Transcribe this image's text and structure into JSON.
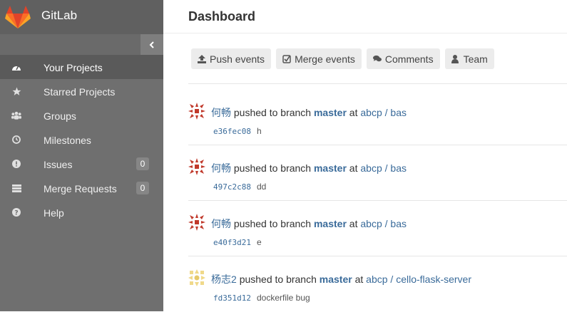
{
  "app": {
    "brand": "GitLab"
  },
  "sidebar": {
    "items": [
      {
        "label": "Your Projects",
        "icon": "dashboard-icon",
        "active": true,
        "count": null
      },
      {
        "label": "Starred Projects",
        "icon": "star-icon",
        "active": false,
        "count": null
      },
      {
        "label": "Groups",
        "icon": "users-icon",
        "active": false,
        "count": null
      },
      {
        "label": "Milestones",
        "icon": "clock-icon",
        "active": false,
        "count": null
      },
      {
        "label": "Issues",
        "icon": "exclamation-circle-icon",
        "active": false,
        "count": "0"
      },
      {
        "label": "Merge Requests",
        "icon": "list-icon",
        "active": false,
        "count": "0"
      },
      {
        "label": "Help",
        "icon": "question-circle-icon",
        "active": false,
        "count": null
      }
    ]
  },
  "main": {
    "title": "Dashboard",
    "filters": [
      {
        "label": "Push events",
        "icon": "upload-icon"
      },
      {
        "label": "Merge events",
        "icon": "check-square-icon"
      },
      {
        "label": "Comments",
        "icon": "comments-icon"
      },
      {
        "label": "Team",
        "icon": "user-icon"
      }
    ],
    "events": [
      {
        "author": "何畅",
        "action": "pushed to branch",
        "branch": "master",
        "at": "at",
        "project": "abcp / bas",
        "sha": "e36fec08",
        "message": "h"
      },
      {
        "author": "何畅",
        "action": "pushed to branch",
        "branch": "master",
        "at": "at",
        "project": "abcp / bas",
        "sha": "497c2c88",
        "message": "dd"
      },
      {
        "author": "何畅",
        "action": "pushed to branch",
        "branch": "master",
        "at": "at",
        "project": "abcp / bas",
        "sha": "e40f3d21",
        "message": "e"
      },
      {
        "author": "杨志2",
        "action": "pushed to branch",
        "branch": "master",
        "at": "at",
        "project": "abcp / cello-flask-server",
        "sha": "fd351d12",
        "message": "dockerfile bug"
      }
    ]
  },
  "colors": {
    "sidebar_bg": "#6f6f6f",
    "sidebar_active": "#5a5a5a",
    "link": "#3a6b9a",
    "logo_orange": "#e24329",
    "avatar_red": "#c0392b",
    "avatar_yellow": "#f0d98a"
  }
}
